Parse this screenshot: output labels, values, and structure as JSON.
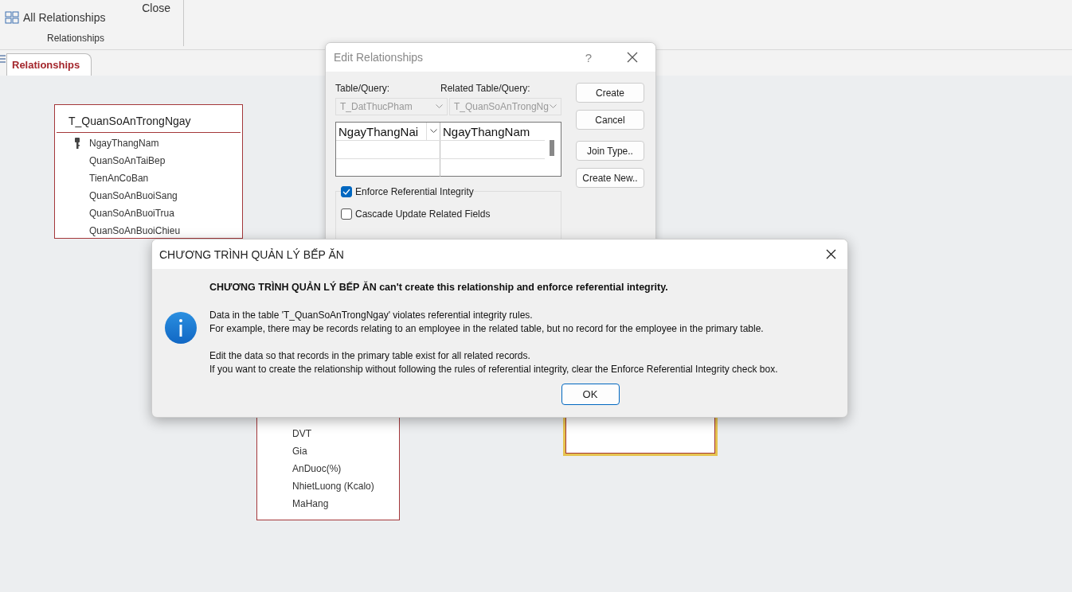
{
  "ribbon": {
    "command": "All Relationships",
    "close_label": "Close",
    "group_label": "Relationships"
  },
  "document_tab": {
    "label": "Relationships",
    "selected": true
  },
  "tables": [
    {
      "title": "T_QuanSoAnTrongNgay",
      "selected": false,
      "fields": [
        {
          "name": "NgayThangNam",
          "primary_key": true
        },
        {
          "name": "QuanSoAnTaiBep",
          "primary_key": false
        },
        {
          "name": "TienAnCoBan",
          "primary_key": false
        },
        {
          "name": "QuanSoAnBuoiSang",
          "primary_key": false
        },
        {
          "name": "QuanSoAnBuoiTrua",
          "primary_key": false
        },
        {
          "name": "QuanSoAnBuoiChieu",
          "primary_key": false
        }
      ]
    },
    {
      "selected": false,
      "fields": [
        {
          "name": "DVT",
          "primary_key": false
        },
        {
          "name": "Gia",
          "primary_key": false
        },
        {
          "name": "AnDuoc(%)",
          "primary_key": false
        },
        {
          "name": "NhietLuong (Kcalo)",
          "primary_key": false
        },
        {
          "name": "MaHang",
          "primary_key": false
        }
      ]
    },
    {
      "selected": true
    }
  ],
  "edit_dialog": {
    "title": "Edit Relationships",
    "help": "?",
    "table_label": "Table/Query:",
    "related_label": "Related Table/Query:",
    "table": {
      "value": "T_DatThucPham",
      "disabled": true
    },
    "related_table": {
      "value": "T_QuanSoAnTrongNg",
      "disabled": true
    },
    "field_pairs": [
      {
        "field": "NgayThangNai",
        "related_field": "NgayThangNam"
      }
    ],
    "options": [
      {
        "label": "Enforce Referential Integrity",
        "checked": true
      },
      {
        "label": "Cascade Update Related Fields",
        "checked": false
      }
    ],
    "buttons": [
      "Create",
      "Cancel",
      "Join Type..",
      "Create New.."
    ]
  },
  "message_box": {
    "title": "CHƯƠNG TRÌNH QUẢN LÝ BẾP ĂN",
    "heading": "CHƯƠNG TRÌNH QUẢN LÝ BẾP ĂN can't create this relationship and enforce referential integrity.",
    "paragraphs": [
      [
        "Data in the table 'T_QuanSoAnTrongNgay' violates referential integrity rules.",
        "For example, there may be records relating to an employee in the related table, but no record for the employee in the primary table."
      ],
      [
        "Edit the data so that records in the primary table exist for all related records.",
        "If you want to create the relationship without following the rules of referential integrity, clear the Enforce Referential Integrity check box."
      ]
    ],
    "button": "OK"
  }
}
